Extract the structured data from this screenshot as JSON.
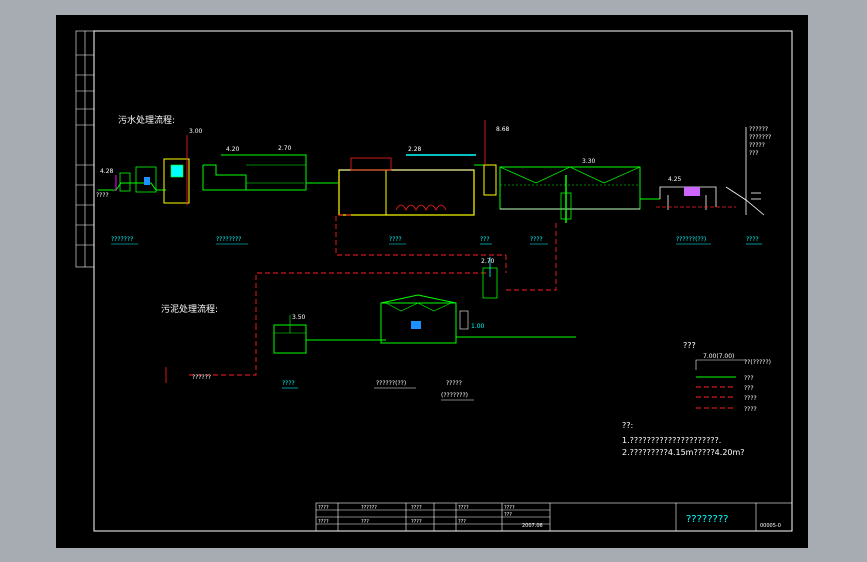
{
  "drawing": {
    "water_section_title": "污水处理流程:",
    "sludge_section_title": "污泥处理流程:",
    "process_units": [
      {
        "label": "???????"
      },
      {
        "label": "????????"
      },
      {
        "label": "????"
      },
      {
        "label": "???"
      },
      {
        "label": "????"
      },
      {
        "label": "??????(??)"
      },
      {
        "label": "????"
      }
    ],
    "sludge_units": [
      {
        "label": "????"
      },
      {
        "label": "??????(??)"
      },
      {
        "label": "?????"
      },
      {
        "label": "(???????)"
      }
    ],
    "inflow_label": "????",
    "sludge_out_label": "??????",
    "right_elevations": [
      "??????",
      "???????",
      "?????",
      "???"
    ],
    "elevations": {
      "e1": "4.28",
      "e2": "3.00",
      "e3": "4.20",
      "e4": "2.70",
      "e5": "2.28",
      "e6": "8.68",
      "e7": "3.30",
      "e8": "4.25",
      "e9": "2.70",
      "e10": "3.50",
      "e11": "1.00"
    },
    "legend": {
      "title": "???",
      "level_mark": "7.00(7.00)",
      "level_desc": "??(?????)",
      "rows": [
        {
          "label": "???",
          "color": "#00ff00"
        },
        {
          "label": "???",
          "color": "#ff2020"
        },
        {
          "label": "????",
          "color": "#ff2020"
        },
        {
          "label": "????",
          "color": "#ff2020"
        }
      ]
    },
    "notes": {
      "heading": "??:",
      "line1": "1.?????????????????????.",
      "line2": "2.?????????4.15m?????4.20m?"
    },
    "title_block": {
      "drawing_title": "????????",
      "drawing_no": "00005-0",
      "date": "2007.06",
      "scale_label": "???",
      "cells": [
        "????",
        "??????",
        "????",
        "????",
        "????",
        "????",
        "???",
        "????",
        "???"
      ]
    },
    "colors": {
      "frame": "#ffffff",
      "water_line": "#00ff00",
      "sludge_line": "#ff2020",
      "tank": "#ffff00",
      "structure": "#00ff00",
      "annotation": "#00ffff",
      "accent": "#ff00ff"
    }
  }
}
